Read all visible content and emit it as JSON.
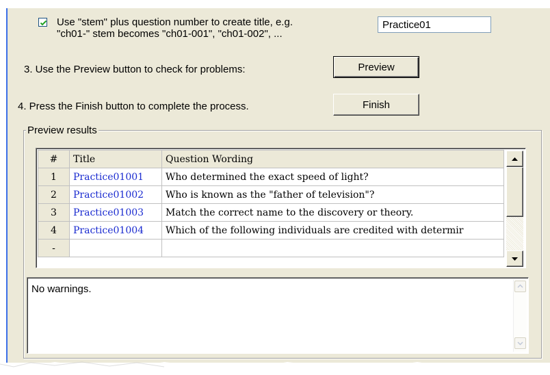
{
  "options": {
    "use_stem_checked": true,
    "use_stem_line1": "Use \"stem\" plus question number to create title,  e.g.",
    "use_stem_line2": "\"ch01-\" stem becomes \"ch01-001\",  \"ch01-002\",  ...",
    "stem_value": "Practice01"
  },
  "steps": {
    "preview_text": "3.  Use the Preview button to check for problems:",
    "preview_button": "Preview",
    "finish_text": "4.  Press the Finish button to complete the process.",
    "finish_button": "Finish"
  },
  "preview_results": {
    "group_label": "Preview results",
    "columns": [
      "#",
      "Title",
      "Question Wording"
    ],
    "rows": [
      {
        "num": "1",
        "title": "Practice01001",
        "wording": "Who determined the exact speed of light?"
      },
      {
        "num": "2",
        "title": "Practice01002",
        "wording": "Who is known as the \"father of television\"?"
      },
      {
        "num": "3",
        "title": "Practice01003",
        "wording": "Match the correct name to the discovery or theory."
      },
      {
        "num": "4",
        "title": "Practice01004",
        "wording": "Which of the following individuals are credited with determir"
      },
      {
        "num": "-",
        "title": "",
        "wording": ""
      }
    ]
  },
  "warnings": {
    "text": "No warnings."
  },
  "colors": {
    "dialog_bg": "#ece9d8",
    "title_link": "#1a2bd0",
    "accent_edge": "#3a6ee8"
  }
}
